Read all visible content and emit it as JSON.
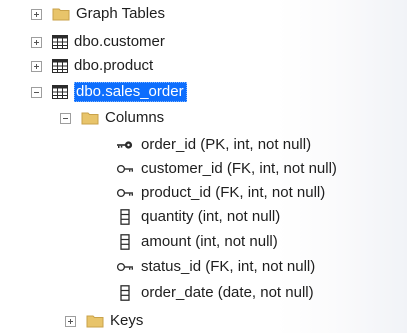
{
  "tree": {
    "graph_tables": {
      "label": "Graph Tables",
      "toggle_icon": "plus-icon",
      "icon": "folder-icon"
    },
    "customer": {
      "label": "dbo.customer",
      "toggle_icon": "plus-icon",
      "icon": "table-icon"
    },
    "product": {
      "label": "dbo.product",
      "toggle_icon": "plus-icon",
      "icon": "table-icon"
    },
    "sales_order": {
      "label": "dbo.sales_order",
      "toggle_icon": "minus-icon",
      "icon": "table-icon",
      "selected": true
    },
    "columns_folder": {
      "label": "Columns",
      "toggle_icon": "minus-icon",
      "icon": "folder-icon"
    },
    "columns": [
      {
        "label": "order_id (PK, int, not null)",
        "icon": "primary-key-icon"
      },
      {
        "label": "customer_id (FK, int, not null)",
        "icon": "foreign-key-icon"
      },
      {
        "label": "product_id (FK, int, not null)",
        "icon": "foreign-key-icon"
      },
      {
        "label": "quantity (int, not null)",
        "icon": "column-icon"
      },
      {
        "label": "amount (int, not null)",
        "icon": "column-icon"
      },
      {
        "label": "status_id (FK, int, not null)",
        "icon": "foreign-key-icon"
      },
      {
        "label": "order_date (date, not null)",
        "icon": "column-icon"
      }
    ],
    "keys_folder": {
      "label": "Keys",
      "toggle_icon": "plus-icon",
      "icon": "folder-icon"
    }
  },
  "colors": {
    "selection": "#0d6efd",
    "folder": "#e8c46a",
    "table_icon": "#2b2b2b"
  }
}
